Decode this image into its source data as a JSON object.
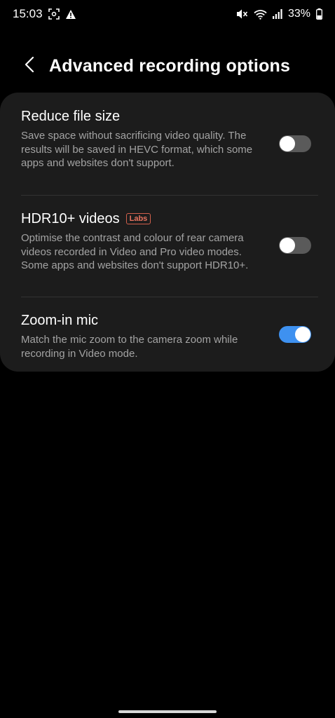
{
  "status_bar": {
    "time": "15:03",
    "battery_percent": "33%",
    "icons_left": [
      "screenshot-icon",
      "warning-icon"
    ],
    "icons_right": [
      "mute-icon",
      "wifi-icon",
      "signal-icon",
      "battery-icon"
    ]
  },
  "header": {
    "back_icon": "chevron-left-icon",
    "title": "Advanced recording options"
  },
  "settings": [
    {
      "title": "Reduce file size",
      "description": "Save space without sacrificing video quality. The results will be saved in HEVC format, which some apps and websites don't support.",
      "enabled": false
    },
    {
      "title": "HDR10+ videos",
      "badge": "Labs",
      "description": "Optimise the contrast and colour of rear camera videos recorded in Video and Pro video modes. Some apps and websites don't support HDR10+.",
      "enabled": false
    },
    {
      "title": "Zoom-in mic",
      "description": "Match the mic zoom to the camera zoom while recording in Video mode.",
      "enabled": true
    }
  ],
  "colors": {
    "background": "#000000",
    "card": "#1c1c1c",
    "toggle_on": "#3e91f0",
    "toggle_off": "#5a5a5a",
    "badge": "#e8735f",
    "description_text": "#a3a3a3"
  }
}
